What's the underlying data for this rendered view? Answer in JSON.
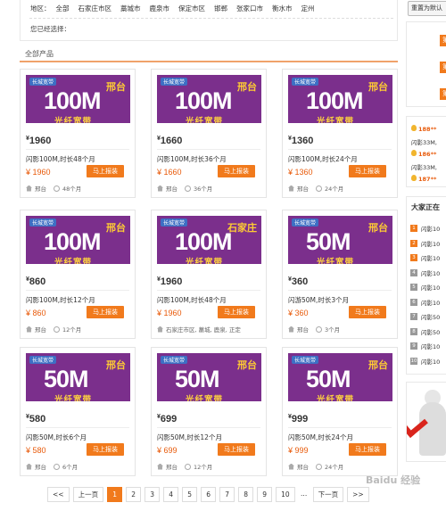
{
  "filter": {
    "region_label": "地区：",
    "regions": [
      "全部",
      "石家庄市区",
      "藁城市",
      "鹿泉市",
      "保定市区",
      "邯郸",
      "张家口市",
      "衡水市",
      "定州"
    ],
    "selected_label": "您已经选择："
  },
  "section_title": "全部产品",
  "products": [
    {
      "banner_city": "邢台",
      "banner_speed": "100M",
      "banner_sub": "光纤宽带",
      "bubble": "",
      "big_price": "1960",
      "name": "闪影100M,时长48个月",
      "price": "¥ 1960",
      "button": "马上报装",
      "location": "邢台",
      "duration": "48个月"
    },
    {
      "banner_city": "邢台",
      "banner_speed": "100M",
      "banner_sub": "光纤宽带",
      "bubble": "",
      "big_price": "1660",
      "name": "闪影100M,时长36个月",
      "price": "¥ 1660",
      "button": "马上报装",
      "location": "邢台",
      "duration": "36个月"
    },
    {
      "banner_city": "邢台",
      "banner_speed": "100M",
      "banner_sub": "光纤宽带",
      "bubble": "",
      "big_price": "1360",
      "name": "闪影100M,时长24个月",
      "price": "¥ 1360",
      "button": "马上报装",
      "location": "邢台",
      "duration": "24个月"
    },
    {
      "banner_city": "邢台",
      "banner_speed": "100M",
      "banner_sub": "光纤宽带",
      "bubble": "",
      "big_price": "860",
      "name": "闪影100M,时长12个月",
      "price": "¥ 860",
      "button": "马上报装",
      "location": "邢台",
      "duration": "12个月"
    },
    {
      "banner_city": "石家庄",
      "banner_speed": "100M",
      "banner_sub": "光纤宽带",
      "bubble": "",
      "big_price": "1960",
      "name": "闪影100M,时长48个月",
      "price": "¥ 1960",
      "button": "马上报装",
      "location": "石家庄市区, 藁城, 鹿泉, 正定",
      "duration": ""
    },
    {
      "banner_city": "邢台",
      "banner_speed": "50M",
      "banner_sub": "光纤宽带",
      "bubble": "",
      "big_price": "360",
      "name": "闪游50M,时长3个月",
      "price": "¥ 360",
      "button": "马上报装",
      "location": "邢台",
      "duration": "3个月"
    },
    {
      "banner_city": "邢台",
      "banner_speed": "50M",
      "banner_sub": "光纤宽带",
      "bubble": "",
      "big_price": "580",
      "name": "闪影50M,时长6个月",
      "price": "¥ 580",
      "button": "马上报装",
      "location": "邢台",
      "duration": "6个月"
    },
    {
      "banner_city": "邢台",
      "banner_speed": "50M",
      "banner_sub": "光纤宽带",
      "bubble": "",
      "big_price": "699",
      "name": "闪影50M,时长12个月",
      "price": "¥ 699",
      "button": "马上报装",
      "location": "邢台",
      "duration": "12个月"
    },
    {
      "banner_city": "邢台",
      "banner_speed": "50M",
      "banner_sub": "光纤宽带",
      "bubble": "",
      "big_price": "999",
      "name": "闪影50M,时长24个月",
      "price": "¥ 999",
      "button": "马上报装",
      "location": "邢台",
      "duration": "24个月"
    }
  ],
  "pager": {
    "first": "<<",
    "prev": "上一页",
    "pages": [
      "1",
      "2",
      "3",
      "4",
      "5",
      "6",
      "7",
      "8",
      "9",
      "10"
    ],
    "ellipsis": "...",
    "next": "下一页",
    "last": ">>"
  },
  "side": {
    "reset_btn": "重置为默认",
    "rank_tags": [
      "第",
      "第",
      "第"
    ],
    "phones": [
      {
        "num": "188**",
        "text": "闪影33M,"
      },
      {
        "num": "186**",
        "text": "闪影33M,"
      },
      {
        "num": "187**",
        "text": ""
      }
    ],
    "live_title": "大家正在",
    "live_rows": [
      "闪影10",
      "闪影10",
      "闪影10",
      "闪影10",
      "闪影10",
      "闪影10",
      "闪影50",
      "闪影50",
      "闪影10",
      "闪影10"
    ],
    "live_nums": [
      "1",
      "2",
      "3",
      "4",
      "5",
      "6",
      "7",
      "8",
      "9",
      "10"
    ]
  },
  "watermark": "Baidu 经验"
}
